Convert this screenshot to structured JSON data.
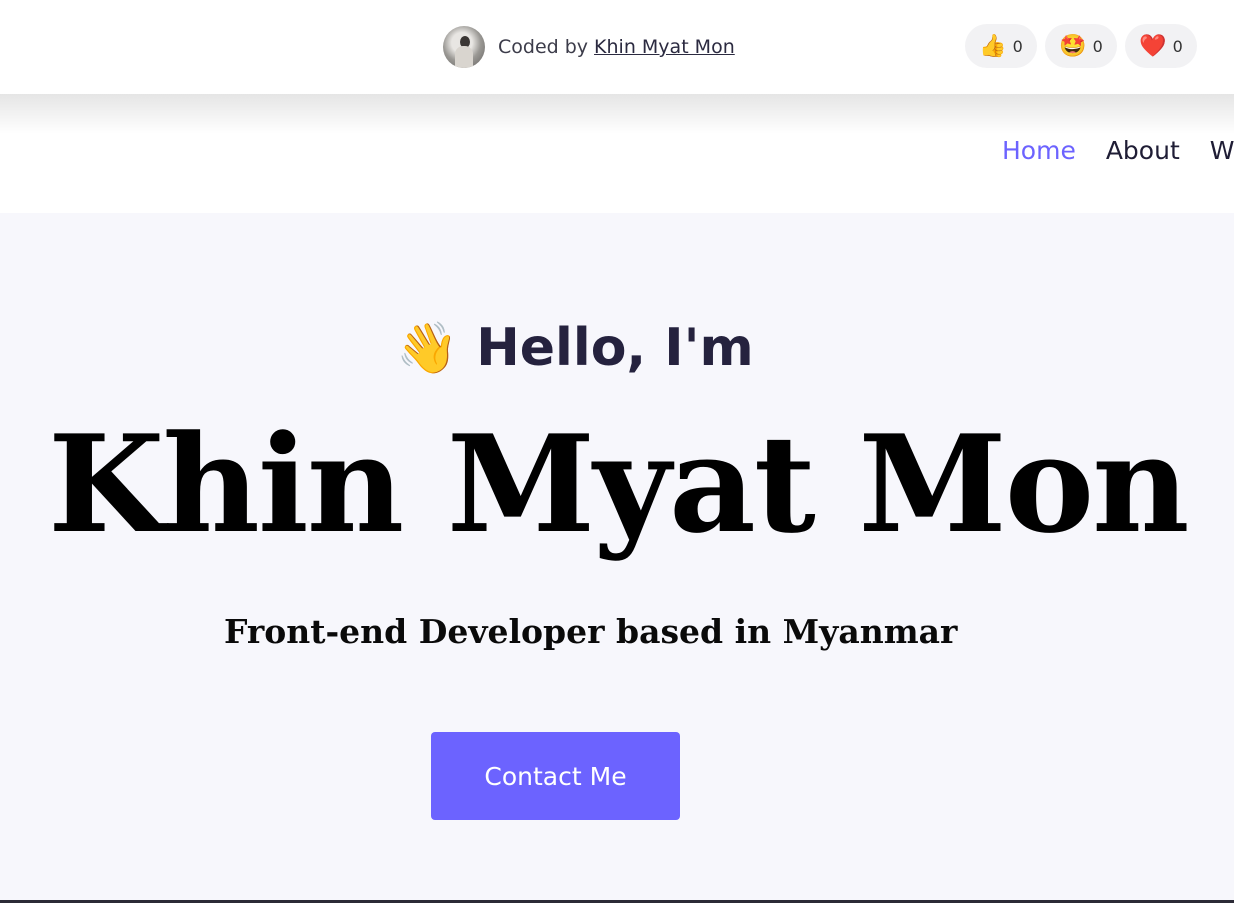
{
  "topbar": {
    "credit_prefix": "Coded by",
    "credit_author": "Khin Myat Mon",
    "reactions": [
      {
        "icon": "thumbs-up-icon",
        "emoji": "👍",
        "count": "0"
      },
      {
        "icon": "star-struck-icon",
        "emoji": "🤩",
        "count": "0"
      },
      {
        "icon": "heart-icon",
        "emoji": "❤️",
        "count": "0"
      }
    ]
  },
  "nav": {
    "items": [
      {
        "label": "Home",
        "active": true
      },
      {
        "label": "About",
        "active": false
      },
      {
        "label": "Wo",
        "active": false
      }
    ]
  },
  "hero": {
    "wave_emoji": "👋",
    "greeting": "Hello, I'm",
    "name": "Khin Myat Mon",
    "subtitle": "Front-end Developer based in Myanmar",
    "cta_label": "Contact Me"
  },
  "colors": {
    "accent": "#6c63ff",
    "hero_bg": "#f7f7fc",
    "heading_dark": "#25223e"
  }
}
